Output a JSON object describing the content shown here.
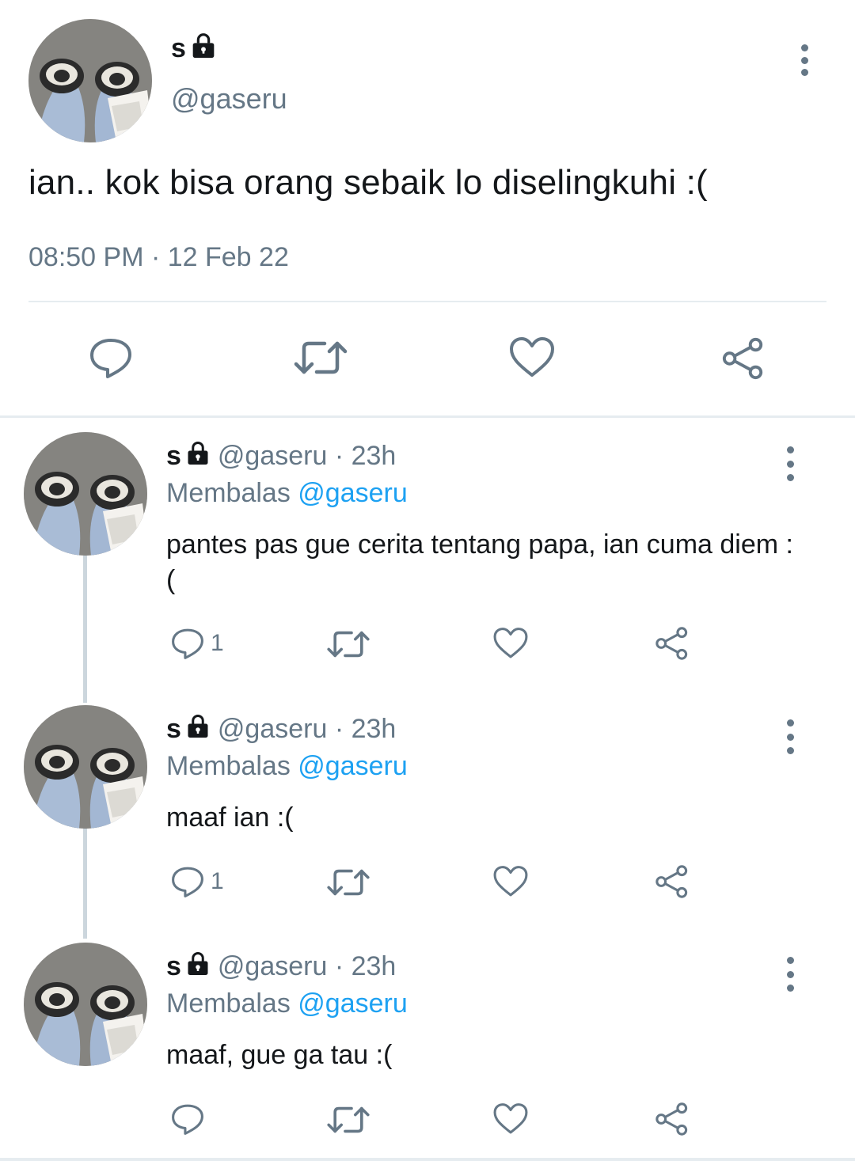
{
  "main_tweet": {
    "name": "s",
    "handle": "@gaseru",
    "text": "ian.. kok bisa orang sebaik lo diselingkuhi :(",
    "timestamp": "08:50 PM · 12 Feb 22",
    "icons": [
      "comment-icon",
      "retweet-icon",
      "like-icon",
      "share-icon"
    ]
  },
  "replies": [
    {
      "name": "s",
      "handle_time": "@gaseru · 23h",
      "replying_label": "Membalas",
      "replying_to": "@gaseru",
      "text": "pantes pas gue cerita tentang papa, ian cuma diem :(",
      "comment_count": "1"
    },
    {
      "name": "s",
      "handle_time": "@gaseru · 23h",
      "replying_label": "Membalas",
      "replying_to": "@gaseru",
      "text": "maaf ian :(",
      "comment_count": "1"
    },
    {
      "name": "s",
      "handle_time": "@gaseru · 23h",
      "replying_label": "Membalas",
      "replying_to": "@gaseru",
      "text": "maaf, gue ga tau :(",
      "comment_count": ""
    }
  ],
  "colors": {
    "text": "#14171a",
    "secondary": "#657786",
    "accent": "#1da1f2",
    "divider": "#e6ecf0",
    "thread_line": "#ccd6dd"
  }
}
